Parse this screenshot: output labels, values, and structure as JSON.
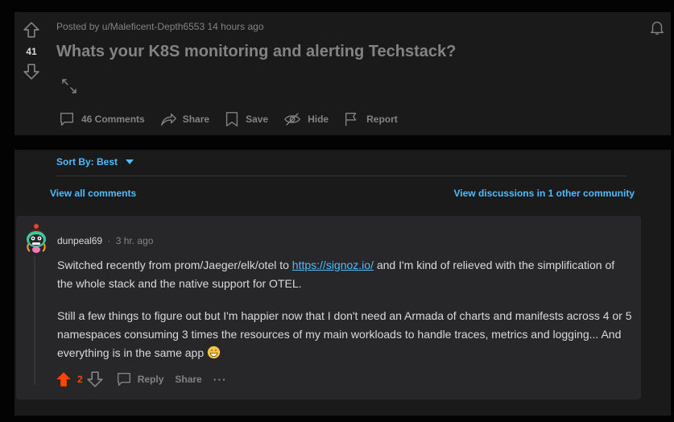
{
  "post": {
    "meta": "Posted by u/Maleficent-Depth6553 14 hours ago",
    "title": "Whats your K8S monitoring and alerting Techstack?",
    "votes": "41",
    "actions": {
      "comments": "46 Comments",
      "share": "Share",
      "save": "Save",
      "hide": "Hide",
      "report": "Report"
    }
  },
  "comments_panel": {
    "sort_label": "Sort By: Best",
    "view_all": "View all comments",
    "view_other": "View discussions in 1 other community"
  },
  "comment": {
    "author": "dunpeal69",
    "separator": "·",
    "time": "3 hr. ago",
    "p1_before": "Switched recently from prom/Jaeger/elk/otel to ",
    "p1_link": "https://signoz.io/",
    "p1_after": " and I'm kind of relieved with the simplification of the whole stack and the native support for OTEL.",
    "p2": "Still a few things to figure out but I'm happier now that I don't need an Armada of charts and manifests across 4 or 5 namespaces consuming 3 times the resources of my main workloads to handle traces, metrics and logging... And everything is in the same app",
    "votes": "2",
    "reply": "Reply",
    "share": "Share",
    "more": "···"
  },
  "colors": {
    "background": "#030303",
    "panel": "#1a1a1b",
    "comment_bg": "#272729",
    "link": "#4fbcff",
    "upvote": "#ff4500",
    "muted": "#818384"
  },
  "icons": [
    "upvote-icon",
    "downvote-icon",
    "expand-icon",
    "bell-icon",
    "comment-icon",
    "share-icon",
    "save-icon",
    "hide-icon",
    "report-icon",
    "caret-down-icon",
    "reply-icon",
    "emoji-icon"
  ]
}
